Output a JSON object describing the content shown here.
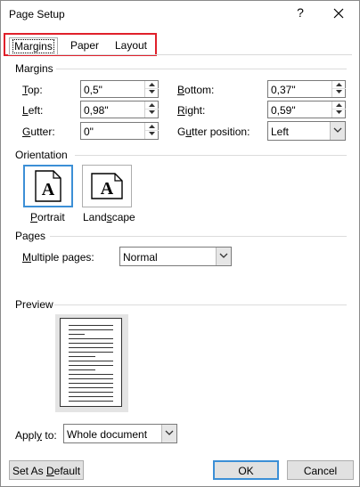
{
  "window": {
    "title": "Page Setup",
    "help": "?"
  },
  "tabs": [
    {
      "label": "Margins",
      "selected": true
    },
    {
      "label": "Paper",
      "selected": false
    },
    {
      "label": "Layout",
      "selected": false
    }
  ],
  "margins": {
    "section_label": "Margins",
    "top": {
      "label": "Top:",
      "value": "0,5\""
    },
    "bottom": {
      "label": "Bottom:",
      "value": "0,37\""
    },
    "left": {
      "label": "Left:",
      "value": "0,98\""
    },
    "right": {
      "label": "Right:",
      "value": "0,59\""
    },
    "gutter": {
      "label": "Gutter:",
      "value": "0\""
    },
    "gutter_position": {
      "label": "Gutter position:",
      "value": "Left"
    }
  },
  "orientation": {
    "section_label": "Orientation",
    "portrait": {
      "label": "Portrait",
      "glyph": "A",
      "selected": true
    },
    "landscape": {
      "label": "Landscape",
      "glyph": "A",
      "selected": false
    }
  },
  "pages": {
    "section_label": "Pages",
    "multiple_pages": {
      "label": "Multiple pages:",
      "value": "Normal"
    }
  },
  "preview": {
    "section_label": "Preview"
  },
  "apply_to": {
    "label": "Apply to:",
    "value": "Whole document"
  },
  "buttons": {
    "set_default": "Set As Default",
    "ok": "OK",
    "cancel": "Cancel"
  },
  "colors": {
    "tab_highlight": "#e0202a",
    "focus_accent": "#3c8fd6"
  }
}
